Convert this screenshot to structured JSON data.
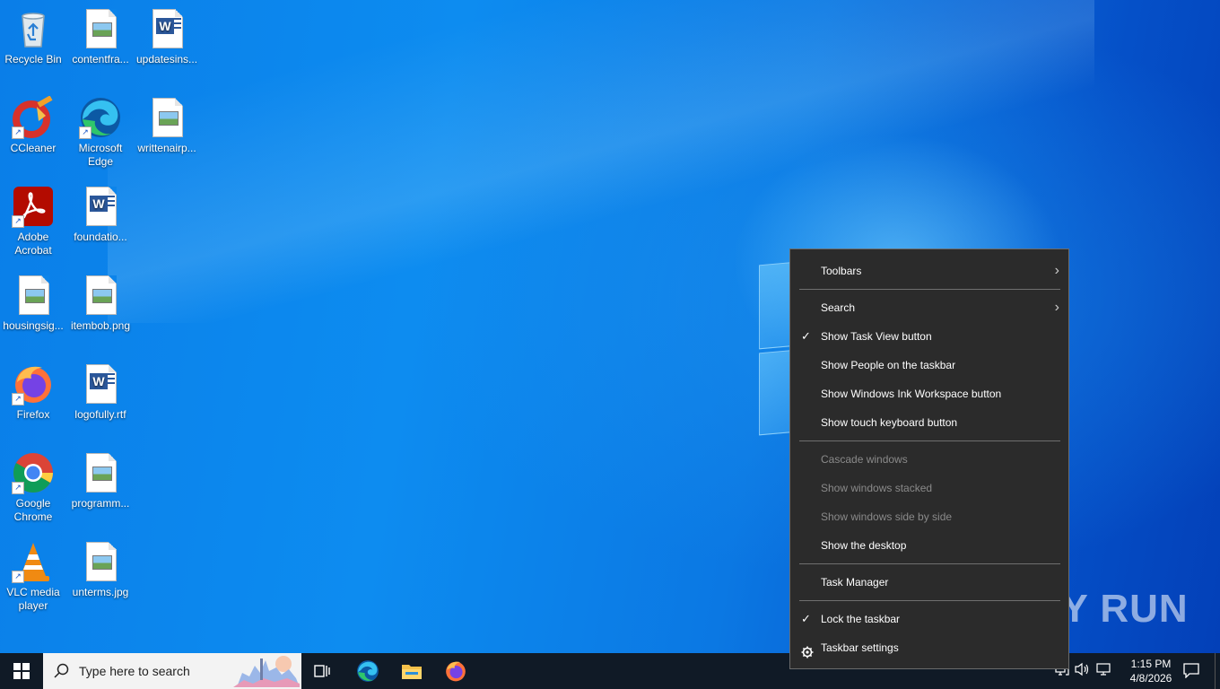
{
  "desktop": {
    "icons": [
      {
        "label": "Recycle Bin"
      },
      {
        "label": "contentfra..."
      },
      {
        "label": "updatesins..."
      },
      {
        "label": "CCleaner"
      },
      {
        "label": "Microsoft Edge"
      },
      {
        "label": "writtenairp..."
      },
      {
        "label": "Adobe Acrobat"
      },
      {
        "label": "foundatio..."
      },
      {
        "label": "housingsig..."
      },
      {
        "label": "itembob.png"
      },
      {
        "label": "Firefox"
      },
      {
        "label": "logofully.rtf"
      },
      {
        "label": "Google Chrome"
      },
      {
        "label": "programm..."
      },
      {
        "label": "VLC media player"
      },
      {
        "label": "unterms.jpg"
      }
    ]
  },
  "context_menu": {
    "items": [
      {
        "label": "Toolbars",
        "has_submenu": true,
        "checked": false,
        "disabled": false
      },
      {
        "label": "Search",
        "has_submenu": true,
        "checked": false,
        "disabled": false
      },
      {
        "label": "Show Task View button",
        "checked": true,
        "disabled": false
      },
      {
        "label": "Show People on the taskbar",
        "checked": false,
        "disabled": false
      },
      {
        "label": "Show Windows Ink Workspace button",
        "checked": false,
        "disabled": false
      },
      {
        "label": "Show touch keyboard button",
        "checked": false,
        "disabled": false
      },
      {
        "label": "Cascade windows",
        "checked": false,
        "disabled": true
      },
      {
        "label": "Show windows stacked",
        "checked": false,
        "disabled": true
      },
      {
        "label": "Show windows side by side",
        "checked": false,
        "disabled": true
      },
      {
        "label": "Show the desktop",
        "checked": false,
        "disabled": false
      },
      {
        "label": "Task Manager",
        "checked": false,
        "disabled": false
      },
      {
        "label": "Lock the taskbar",
        "checked": true,
        "disabled": false
      },
      {
        "label": "Taskbar settings",
        "icon": "gear-icon",
        "checked": false,
        "disabled": false
      }
    ],
    "checkmark": "✓",
    "submenu_arrow": "›"
  },
  "taskbar": {
    "search_placeholder": "Type here to search",
    "pinned": [
      "task-view-icon",
      "edge-icon",
      "file-explorer-icon",
      "firefox-icon"
    ],
    "clock": {
      "time": "1:15 PM",
      "date": "4/8/2026"
    }
  },
  "watermark": {
    "text": "ANY RUN"
  },
  "colors": {
    "menu_bg": "#2b2b2b",
    "menu_disabled_text": "#8a8a8a",
    "taskbar_bg": "#101a26",
    "desktop_blue": "#0b78e3"
  }
}
